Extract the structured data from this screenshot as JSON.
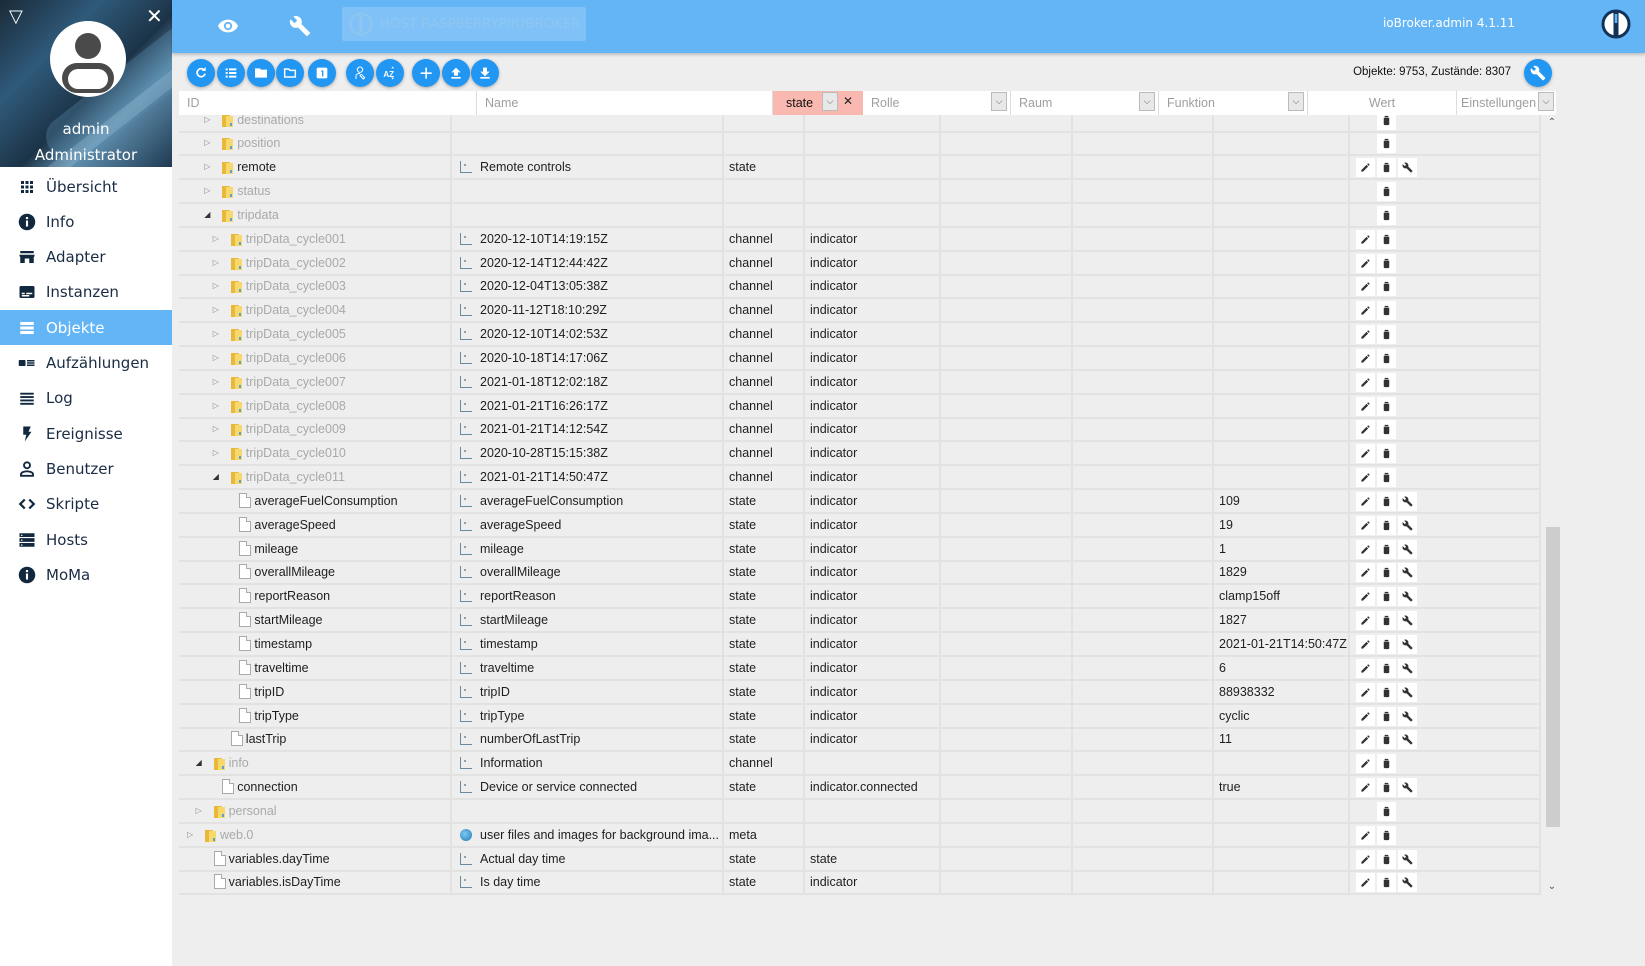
{
  "sidebar": {
    "user_name": "admin",
    "user_role": "Administrator",
    "items": [
      {
        "label": "Übersicht",
        "icon": "apps-grid-icon",
        "active": false
      },
      {
        "label": "Info",
        "icon": "info-icon",
        "active": false
      },
      {
        "label": "Adapter",
        "icon": "store-icon",
        "active": false
      },
      {
        "label": "Instanzen",
        "icon": "subtitles-icon",
        "active": false
      },
      {
        "label": "Objekte",
        "icon": "view-list-icon",
        "active": true
      },
      {
        "label": "Aufzählungen",
        "icon": "enums-icon",
        "active": false
      },
      {
        "label": "Log",
        "icon": "log-lines-icon",
        "active": false
      },
      {
        "label": "Ereignisse",
        "icon": "lightning-icon",
        "active": false
      },
      {
        "label": "Benutzer",
        "icon": "person-icon",
        "active": false
      },
      {
        "label": "Skripte",
        "icon": "code-icon",
        "active": false
      },
      {
        "label": "Hosts",
        "icon": "dns-icon",
        "active": false
      },
      {
        "label": "MoMa",
        "icon": "info-icon",
        "active": false
      }
    ]
  },
  "topbar": {
    "host_label": "HOST RASPBERRYPIIOBROKER",
    "admin_version": "ioBroker.admin 4.1.11"
  },
  "toolbar": {
    "buttons": [
      "refresh-icon",
      "list-view-icon",
      "folder-filled-icon",
      "folder-outline-icon",
      "count-one-icon",
      "expert-mode-icon",
      "sort-az-icon",
      "add-icon",
      "upload-icon",
      "download-icon"
    ],
    "counts_text": "Objekte: 9753, Zustände: 8307"
  },
  "filters": {
    "id_placeholder": "ID",
    "name_placeholder": "Name",
    "type_value": "state",
    "role_placeholder": "Rolle",
    "room_placeholder": "Raum",
    "function_placeholder": "Funktion",
    "value_header": "Wert",
    "settings_header": "Einstellungen"
  },
  "rows": [
    {
      "id": "destinations",
      "kind": "folder",
      "level": 2,
      "expanded": false,
      "dim": true,
      "name": "",
      "name_icon": "",
      "type": "",
      "role": "",
      "value": "",
      "actions": [
        "delete"
      ]
    },
    {
      "id": "position",
      "kind": "folder",
      "level": 2,
      "expanded": false,
      "dim": true,
      "name": "",
      "name_icon": "",
      "type": "",
      "role": "",
      "value": "",
      "actions": [
        "delete"
      ]
    },
    {
      "id": "remote",
      "kind": "folder",
      "level": 2,
      "expanded": false,
      "dim": false,
      "name": "Remote controls",
      "name_icon": "state",
      "type": "state",
      "role": "",
      "value": "",
      "actions": [
        "edit",
        "delete",
        "settings"
      ]
    },
    {
      "id": "status",
      "kind": "folder",
      "level": 2,
      "expanded": false,
      "dim": true,
      "name": "",
      "name_icon": "",
      "type": "",
      "role": "",
      "value": "",
      "actions": [
        "delete"
      ]
    },
    {
      "id": "tripdata",
      "kind": "folder",
      "level": 2,
      "expanded": true,
      "dim": true,
      "name": "",
      "name_icon": "",
      "type": "",
      "role": "",
      "value": "",
      "actions": [
        "delete"
      ]
    },
    {
      "id": "tripData_cycle001",
      "kind": "folder",
      "level": 3,
      "expanded": false,
      "dim": true,
      "name": "2020-12-10T14:19:15Z",
      "name_icon": "channel",
      "type": "channel",
      "role": "indicator",
      "value": "",
      "actions": [
        "edit",
        "delete"
      ]
    },
    {
      "id": "tripData_cycle002",
      "kind": "folder",
      "level": 3,
      "expanded": false,
      "dim": true,
      "name": "2020-12-14T12:44:42Z",
      "name_icon": "channel",
      "type": "channel",
      "role": "indicator",
      "value": "",
      "actions": [
        "edit",
        "delete"
      ]
    },
    {
      "id": "tripData_cycle003",
      "kind": "folder",
      "level": 3,
      "expanded": false,
      "dim": true,
      "name": "2020-12-04T13:05:38Z",
      "name_icon": "channel",
      "type": "channel",
      "role": "indicator",
      "value": "",
      "actions": [
        "edit",
        "delete"
      ]
    },
    {
      "id": "tripData_cycle004",
      "kind": "folder",
      "level": 3,
      "expanded": false,
      "dim": true,
      "name": "2020-11-12T18:10:29Z",
      "name_icon": "channel",
      "type": "channel",
      "role": "indicator",
      "value": "",
      "actions": [
        "edit",
        "delete"
      ]
    },
    {
      "id": "tripData_cycle005",
      "kind": "folder",
      "level": 3,
      "expanded": false,
      "dim": true,
      "name": "2020-12-10T14:02:53Z",
      "name_icon": "channel",
      "type": "channel",
      "role": "indicator",
      "value": "",
      "actions": [
        "edit",
        "delete"
      ]
    },
    {
      "id": "tripData_cycle006",
      "kind": "folder",
      "level": 3,
      "expanded": false,
      "dim": true,
      "name": "2020-10-18T14:17:06Z",
      "name_icon": "channel",
      "type": "channel",
      "role": "indicator",
      "value": "",
      "actions": [
        "edit",
        "delete"
      ]
    },
    {
      "id": "tripData_cycle007",
      "kind": "folder",
      "level": 3,
      "expanded": false,
      "dim": true,
      "name": "2021-01-18T12:02:18Z",
      "name_icon": "channel",
      "type": "channel",
      "role": "indicator",
      "value": "",
      "actions": [
        "edit",
        "delete"
      ]
    },
    {
      "id": "tripData_cycle008",
      "kind": "folder",
      "level": 3,
      "expanded": false,
      "dim": true,
      "name": "2021-01-21T16:26:17Z",
      "name_icon": "channel",
      "type": "channel",
      "role": "indicator",
      "value": "",
      "actions": [
        "edit",
        "delete"
      ]
    },
    {
      "id": "tripData_cycle009",
      "kind": "folder",
      "level": 3,
      "expanded": false,
      "dim": true,
      "name": "2021-01-21T14:12:54Z",
      "name_icon": "channel",
      "type": "channel",
      "role": "indicator",
      "value": "",
      "actions": [
        "edit",
        "delete"
      ]
    },
    {
      "id": "tripData_cycle010",
      "kind": "folder",
      "level": 3,
      "expanded": false,
      "dim": true,
      "name": "2020-10-28T15:15:38Z",
      "name_icon": "channel",
      "type": "channel",
      "role": "indicator",
      "value": "",
      "actions": [
        "edit",
        "delete"
      ]
    },
    {
      "id": "tripData_cycle011",
      "kind": "folder",
      "level": 3,
      "expanded": true,
      "dim": true,
      "name": "2021-01-21T14:50:47Z",
      "name_icon": "channel",
      "type": "channel",
      "role": "indicator",
      "value": "",
      "actions": [
        "edit",
        "delete"
      ]
    },
    {
      "id": "averageFuelConsumption",
      "kind": "file",
      "level": 4,
      "dim": false,
      "name": "averageFuelConsumption",
      "name_icon": "state",
      "type": "state",
      "role": "indicator",
      "value": "109",
      "actions": [
        "edit",
        "delete",
        "settings"
      ]
    },
    {
      "id": "averageSpeed",
      "kind": "file",
      "level": 4,
      "dim": false,
      "name": "averageSpeed",
      "name_icon": "state",
      "type": "state",
      "role": "indicator",
      "value": "19",
      "actions": [
        "edit",
        "delete",
        "settings"
      ]
    },
    {
      "id": "mileage",
      "kind": "file",
      "level": 4,
      "dim": false,
      "name": "mileage",
      "name_icon": "state",
      "type": "state",
      "role": "indicator",
      "value": "1",
      "actions": [
        "edit",
        "delete",
        "settings"
      ]
    },
    {
      "id": "overallMileage",
      "kind": "file",
      "level": 4,
      "dim": false,
      "name": "overallMileage",
      "name_icon": "state",
      "type": "state",
      "role": "indicator",
      "value": "1829",
      "actions": [
        "edit",
        "delete",
        "settings"
      ]
    },
    {
      "id": "reportReason",
      "kind": "file",
      "level": 4,
      "dim": false,
      "name": "reportReason",
      "name_icon": "state",
      "type": "state",
      "role": "indicator",
      "value": "clamp15off",
      "actions": [
        "edit",
        "delete",
        "settings"
      ]
    },
    {
      "id": "startMileage",
      "kind": "file",
      "level": 4,
      "dim": false,
      "name": "startMileage",
      "name_icon": "state",
      "type": "state",
      "role": "indicator",
      "value": "1827",
      "actions": [
        "edit",
        "delete",
        "settings"
      ]
    },
    {
      "id": "timestamp",
      "kind": "file",
      "level": 4,
      "dim": false,
      "name": "timestamp",
      "name_icon": "state",
      "type": "state",
      "role": "indicator",
      "value": "2021-01-21T14:50:47Z",
      "actions": [
        "edit",
        "delete",
        "settings"
      ]
    },
    {
      "id": "traveltime",
      "kind": "file",
      "level": 4,
      "dim": false,
      "name": "traveltime",
      "name_icon": "state",
      "type": "state",
      "role": "indicator",
      "value": "6",
      "actions": [
        "edit",
        "delete",
        "settings"
      ]
    },
    {
      "id": "tripID",
      "kind": "file",
      "level": 4,
      "dim": false,
      "name": "tripID",
      "name_icon": "state",
      "type": "state",
      "role": "indicator",
      "value": "88938332",
      "actions": [
        "edit",
        "delete",
        "settings"
      ]
    },
    {
      "id": "tripType",
      "kind": "file",
      "level": 4,
      "dim": false,
      "name": "tripType",
      "name_icon": "state",
      "type": "state",
      "role": "indicator",
      "value": "cyclic",
      "actions": [
        "edit",
        "delete",
        "settings"
      ]
    },
    {
      "id": "lastTrip",
      "kind": "file",
      "level": 3,
      "dim": false,
      "name": "numberOfLastTrip",
      "name_icon": "state",
      "type": "state",
      "role": "indicator",
      "value": "11",
      "actions": [
        "edit",
        "delete",
        "settings"
      ]
    },
    {
      "id": "info",
      "kind": "folder",
      "level": 1,
      "expanded": true,
      "dim": true,
      "name": "Information",
      "name_icon": "channel",
      "type": "channel",
      "role": "",
      "value": "",
      "actions": [
        "edit",
        "delete"
      ]
    },
    {
      "id": "connection",
      "kind": "file",
      "level": 2,
      "dim": false,
      "name": "Device or service connected",
      "name_icon": "state",
      "type": "state",
      "role": "indicator.connected",
      "value": "true",
      "actions": [
        "edit",
        "delete",
        "settings"
      ]
    },
    {
      "id": "personal",
      "kind": "folder",
      "level": 1,
      "expanded": false,
      "dim": true,
      "name": "",
      "name_icon": "",
      "type": "",
      "role": "",
      "value": "",
      "actions": [
        "delete"
      ]
    },
    {
      "id": "web.0",
      "kind": "folder",
      "level": 0,
      "expanded": false,
      "dim": true,
      "name": "user files and images for background ima...",
      "name_icon": "meta",
      "type": "meta",
      "role": "",
      "value": "",
      "actions": [
        "edit",
        "delete"
      ]
    },
    {
      "id": "variables.dayTime",
      "kind": "file",
      "level": 1,
      "dim": false,
      "name": "Actual day time",
      "name_icon": "state",
      "type": "state",
      "role": "state",
      "value": "",
      "actions": [
        "edit",
        "delete",
        "settings"
      ]
    },
    {
      "id": "variables.isDayTime",
      "kind": "file",
      "level": 1,
      "dim": false,
      "name": "Is day time",
      "name_icon": "state",
      "type": "state",
      "role": "indicator",
      "value": "",
      "actions": [
        "edit",
        "delete",
        "settings"
      ]
    }
  ],
  "scroll": {
    "thumb_start_fraction": 0.53,
    "thumb_size_fraction": 0.4
  },
  "colors": {
    "accent": "#2196f3",
    "topbar": "#64b5f6",
    "active_filter": "#f9b8b0"
  }
}
